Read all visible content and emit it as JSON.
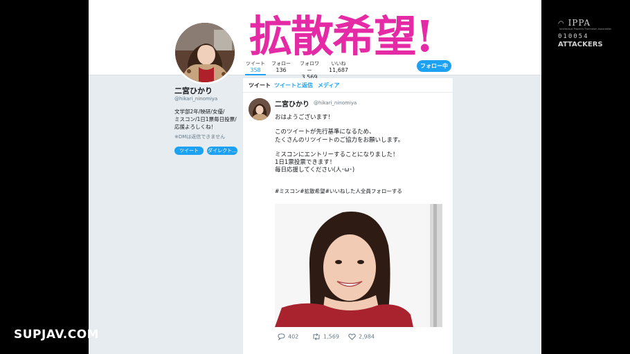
{
  "banner": {
    "title": "拡散希望!"
  },
  "profile": {
    "name": "二宮ひかり",
    "handle": "@hikari_ninomiya",
    "bio_lines": [
      "文学部2年/映研/女優/",
      "ミスコン/1日1票毎日投票/",
      "応援よろしくね！"
    ],
    "dm_note": "※DMは返信できません",
    "tweet_button": "ツイート",
    "direct_button": "ダイレクト..."
  },
  "stats": [
    {
      "label": "ツイート",
      "value": "358"
    },
    {
      "label": "フォロー",
      "value": "136"
    },
    {
      "label": "フォロワー",
      "value": "3,569"
    },
    {
      "label": "いいね",
      "value": "11,687"
    }
  ],
  "follow_button": "フォロー中",
  "timeline": {
    "tabs": [
      "ツイート",
      "ツイートと返信",
      "メディア"
    ],
    "tweet": {
      "name": "二宮ひかり",
      "handle": "@hikari_ninomiya",
      "p1": "おはようございます！",
      "p2_l1": "このツイートが先行基準になるため、",
      "p2_l2": "たくさんのリツイートのご協力をお願いします。",
      "p3_l1": "ミスコンにエントリーすることになりました！",
      "p3_l2": "1日1票投票できます！",
      "p3_l3": "毎日応援してください(人･ω･)",
      "hashtags": "#ミスコン#拡散希望#いいねした人全員フォローする",
      "replies": "402",
      "retweets": "1,569",
      "likes": "2,984"
    }
  },
  "overlay": {
    "brand": "IPPA",
    "brand_small": "Intellectual Property Promotion Association",
    "code": "010054",
    "maker": "ATTACKERS",
    "watermark": "SUPJAV.COM"
  },
  "colors": {
    "accent": "#1da1f2",
    "banner": "#e52aa6",
    "page_bg": "#e6ecf0"
  },
  "icons": [
    "reply-icon",
    "retweet-icon",
    "heart-icon"
  ]
}
